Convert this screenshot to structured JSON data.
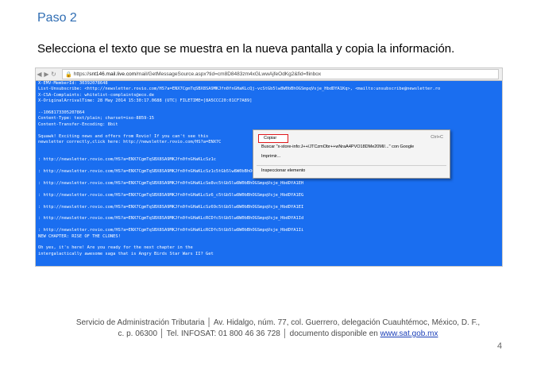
{
  "step_title": "Paso 2",
  "instruction": "Selecciona el texto que se muestra en la nueva pantalla y copia la información.",
  "browser": {
    "url_prefix": "https://",
    "url_host": "snt146.mail.live.com",
    "url_path": "/mail/GetMessageSource.aspx?tid=cm8D8483zm4xGLwwAjfeOdKg2&fid=flinbox"
  },
  "source_lines": [
    "X-EMV-MemberId: 30392078648",
    "List-Unsubscribe: <http://newsletter.rovio.com/HS?a=ENX7CgmTqSBX8SA9MKJfn0fnGHaKLcQj-vcStGb5lw8W0bBhOGSmpqVsje_HbdDYA1Kq>, <mailto:unsubscribe@newsletter.ro",
    "X-CSA-Complaints: whitelist-complaints@eco.de",
    "X-OriginalArrivalTime: 28 May 2014 15:30:17.0688 (UTC) FILETIME=[8A5CCC20:01CF7A89]",
    "",
    "--1068173305207864",
    "Content-Type: text/plain; charset=iso-8859-15",
    "Content-Transfer-Encoding: 8bit",
    "",
    "Squawk! Exciting news and offers from Rovio! If you can't see this",
    "newsletter correctly,click here: http://newsletter.rovio.com/HS?a=ENX7C",
    "",
    "",
    ": http://newsletter.rovio.com/HS?a=ENX7CgmTqSBX8SA9MKJfn0fnGHaKLcSz1c",
    "",
    ": http://newsletter.rovio.com/HS?a=ENX7CgmTqSBX8SA9MKJfn0fnGHaKLcSz1c5tGb5lw8W0bBhOGSmpqVsje_HbdDYA1EF",
    "",
    ": http://newsletter.rovio.com/HS?a=ENX7CgmTqSBX8SA9MKJfn0fnGHaKLcSe8vc5tGb5lw8W0bBhOGSmpqVsje_HbdDYA1EH",
    "",
    ": http://newsletter.rovio.com/HS?a=ENX7CgmTqSBX8SA9MKJfn0fnGHaKLcSz6_c5tGb5lw8W0bBhOGSmpqVsje_HbdDYA1EG",
    "",
    ": http://newsletter.rovio.com/HS?a=ENX7CgmTqSBX8SA9MKJfn0fnGHaKLcSz69c5tGb5lw8W0bBhOGSmpqVsje_HbdDYA1EI",
    "",
    ": http://newsletter.rovio.com/HS?a=ENX7CgmTqSBX8SA9MKJfn0fnGHaKLcRCDfc5tGb5lw8W0bBhOGSmpqVsje_HbdDYA1Id",
    "",
    ": http://newsletter.rovio.com/HS?a=ENX7CgmTqSBX8SA9MKJfn0fnGHaKLcRCDfc5tGb5lw8W0bBhOGSmpqVsje_HbdDYA1Ii",
    "NEW CHAPTER: RISE OF THE CLONES!",
    "",
    "Oh yes, it's here! Are you ready for the next chapter in the",
    "intergalactically awesome saga that is Angry Birds Star Wars II? Get"
  ],
  "context_menu": {
    "copy": "Copiar",
    "copy_shortcut": "Ctrl+C",
    "search": "Buscar \"x-store-info:J++/JTCzmObr++wNraA4PVO18DMe20MI/...\" con Google",
    "print": "Imprimir...",
    "inspect": "Inspeccionar elemento"
  },
  "footer": {
    "line1": "Servicio de Administración Tributaria │ Av. Hidalgo, núm. 77, col. Guerrero, delegación Cuauhtémoc, México, D. F.,",
    "line2_text": "c. p. 06300 │ Tel. INFOSAT: 01 800 46 36 728 │ documento disponible en ",
    "link": "www.sat.gob.mx"
  },
  "page_number": "4",
  "colors": {
    "screen_bg": "#1a6ef0",
    "title_blue": "#2f6db3",
    "highlight_red": "#e0191c"
  }
}
